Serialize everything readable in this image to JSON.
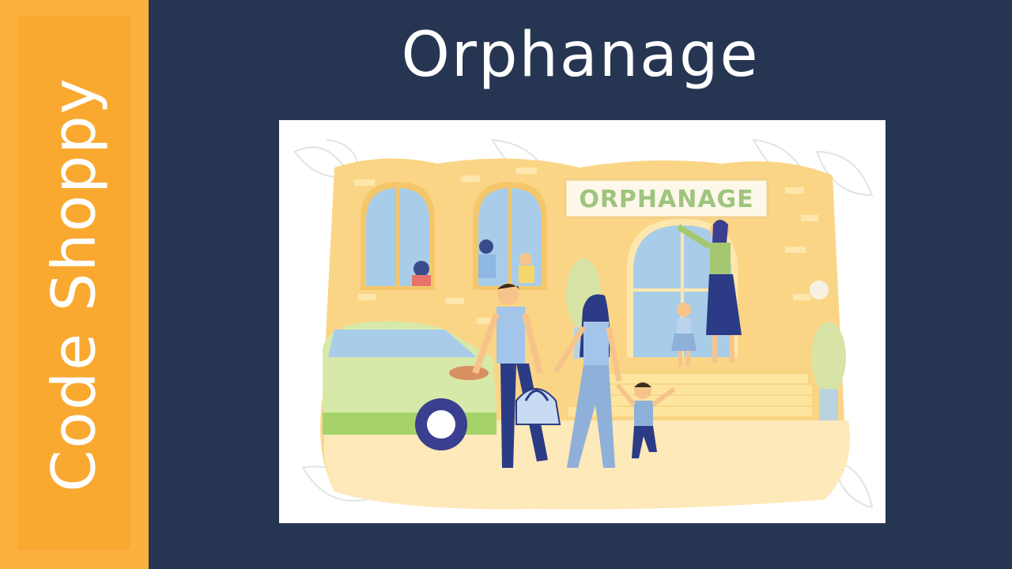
{
  "brand": "Code Shoppy",
  "title": "Orphanage",
  "illustration": {
    "sign_text": "ORPHANAGE"
  },
  "colors": {
    "background": "#263652",
    "sidebar": "#fbb040",
    "sidebar_inner": "#f9a930",
    "text": "#ffffff"
  }
}
